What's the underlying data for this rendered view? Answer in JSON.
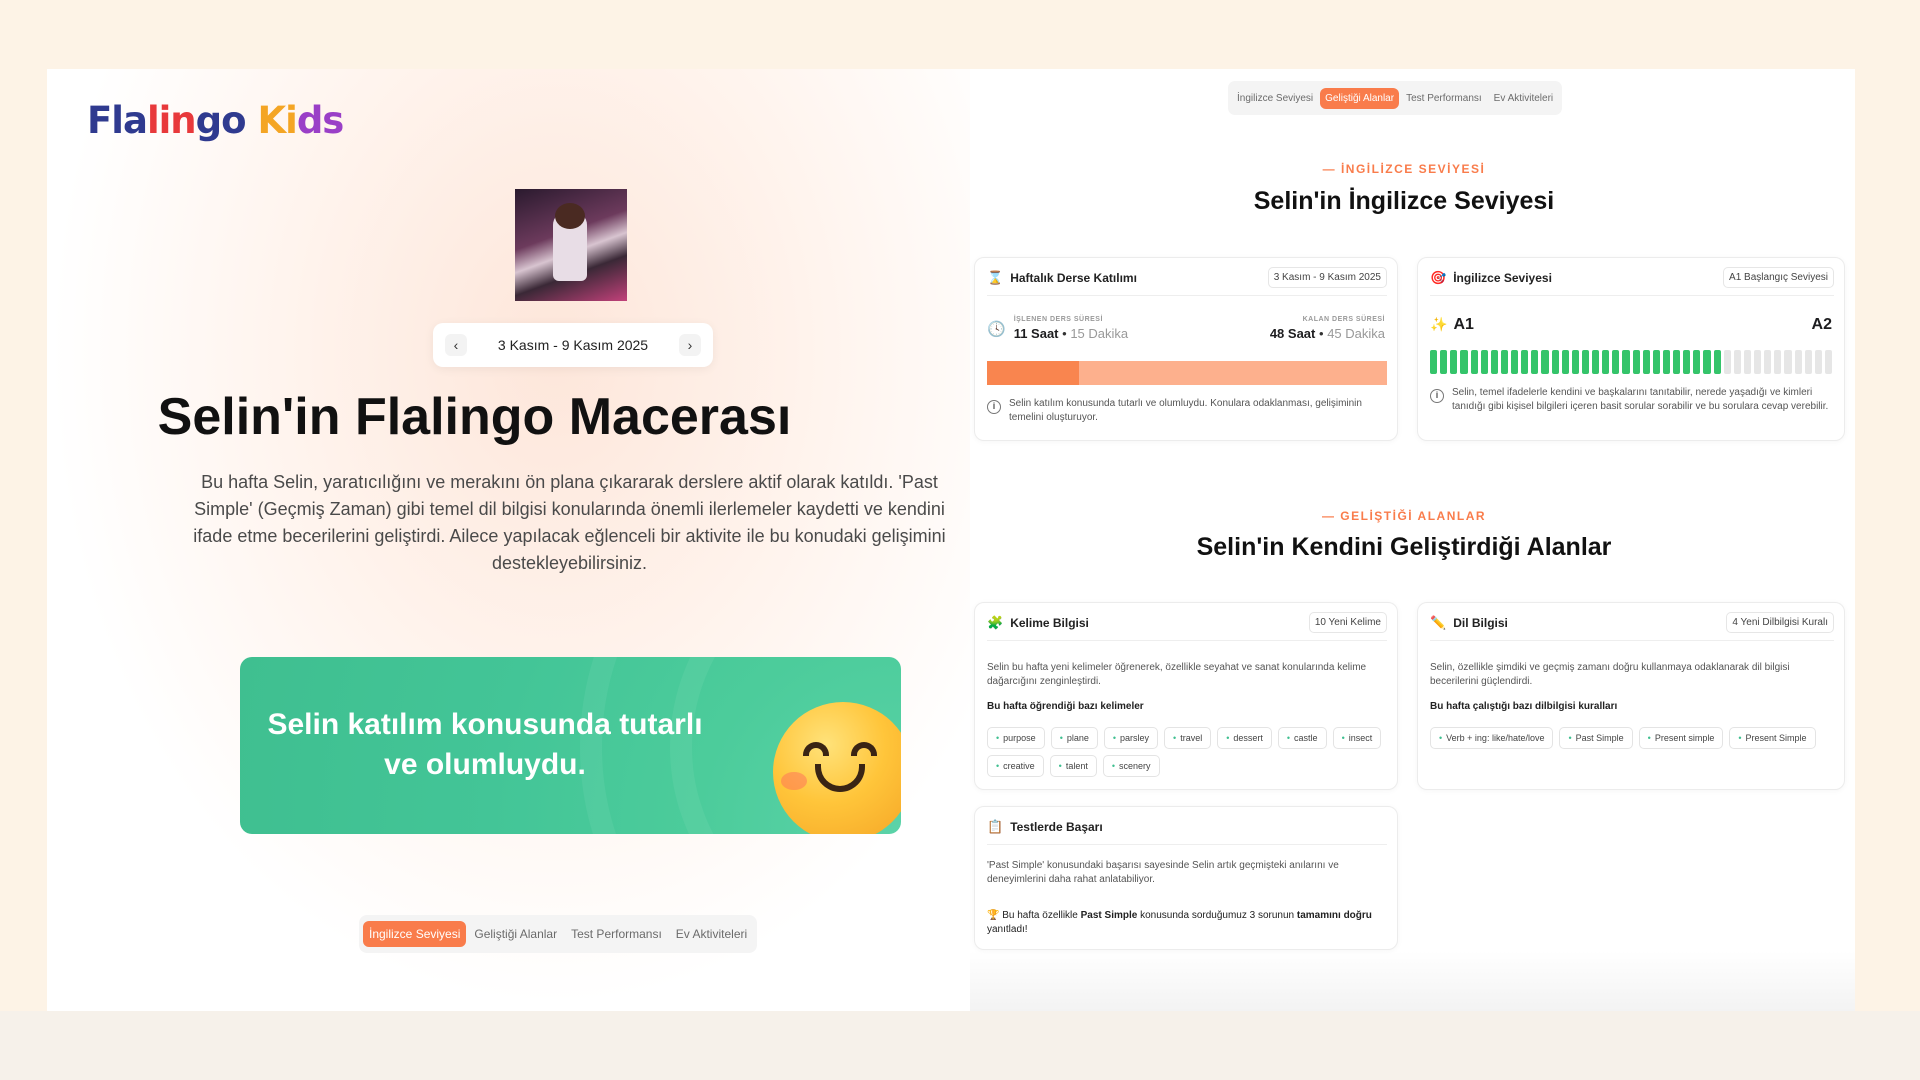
{
  "brand": {
    "parts": [
      "Fla",
      "lin",
      "go ",
      "Ki",
      "ds"
    ]
  },
  "hero": {
    "date_range": "3 Kasım - 9 Kasım 2025",
    "prev_icon": "‹",
    "next_icon": "›",
    "title": "Selin'in Flalingo Macerası",
    "intro": "Bu hafta Selin, yaratıcılığını ve merakını ön plana çıkararak derslere aktif olarak katıldı. 'Past Simple' (Geçmiş Zaman) gibi temel dil bilgisi konularında önemli ilerlemeler kaydetti ve kendini ifade etme becerilerini geliştirdi. Ailece yapılacak eğlenceli bir aktivite ile bu konudaki gelişimini destekleyebilirsiniz.",
    "banner_text": "Selin katılım konusunda tutarlı ve olumluydu."
  },
  "tabs": [
    "İngilizce Seviyesi",
    "Geliştiği Alanlar",
    "Test Performansı",
    "Ev Aktiviteleri"
  ],
  "tabs_active": {
    "bottom": 0,
    "top": 1
  },
  "level_section": {
    "eyebrow": "— İNGİLİZCE SEVİYESİ",
    "title": "Selin'in İngilizce Seviyesi",
    "attendance": {
      "title": "Haftalık Derse Katılımı",
      "pill": "3 Kasım - 9 Kasım 2025",
      "done_label": "İŞLENEN DERS SÜRESİ",
      "done_hours": "11 Saat",
      "done_minutes": "15 Dakika",
      "remaining_label": "KALAN DERS SÜRESİ",
      "remaining_hours": "48 Saat",
      "remaining_minutes": "45 Dakika",
      "progress_fraction": 0.23,
      "note": "Selin katılım konusunda tutarlı ve olumluydu. Konulara odaklanması, gelişiminin temelini oluşturuyor.",
      "icon": "hourglass-icon",
      "clock_icon": "clock-icon"
    },
    "english_level": {
      "title": "İngilizce Seviyesi",
      "pill": "A1 Başlangıç Seviyesi",
      "from": "A1",
      "to": "A2",
      "segments_total": 40,
      "segments_filled": 29,
      "note": "Selin, temel ifadelerle kendini ve başkalarını tanıtabilir, nerede yaşadığı ve kimleri tanıdığı gibi kişisel bilgileri içeren basit sorular sorabilir ve bu sorulara cevap verebilir.",
      "icon": "target-icon",
      "sparkle_icon": "sparkle-icon"
    }
  },
  "growth_section": {
    "eyebrow": "— GELİŞTİĞİ ALANLAR",
    "title": "Selin'in Kendini Geliştirdiği Alanlar",
    "vocab": {
      "title": "Kelime Bilgisi",
      "pill": "10 Yeni Kelime",
      "text": "Selin bu hafta yeni kelimeler öğrenerek, özellikle seyahat ve sanat konularında kelime dağarcığını zenginleştirdi.",
      "sub": "Bu hafta öğrendiği bazı kelimeler",
      "words": [
        "purpose",
        "plane",
        "parsley",
        "travel",
        "dessert",
        "castle",
        "insect",
        "creative",
        "talent",
        "scenery"
      ],
      "icon": "puzzle-icon"
    },
    "grammar": {
      "title": "Dil Bilgisi",
      "pill": "4 Yeni Dilbilgisi Kuralı",
      "text": "Selin, özellikle şimdiki ve geçmiş zamanı doğru kullanmaya odaklanarak dil bilgisi becerilerini güçlendirdi.",
      "sub": "Bu hafta çalıştığı bazı dilbilgisi kuralları",
      "rules": [
        "Verb + ing: like/hate/love",
        "Past Simple",
        "Present simple",
        "Present Simple"
      ],
      "icon": "pencil-icon"
    },
    "tests": {
      "title": "Testlerde Başarı",
      "text": "'Past Simple' konusundaki başarısı sayesinde Selin artık geçmişteki anılarını ve deneyimlerini daha rahat anlatabiliyor.",
      "result_pre": "Bu hafta özellikle ",
      "result_topic": "Past Simple",
      "result_mid": " konusunda sorduğumuz 3 sorunun ",
      "result_strong": "tamamını doğru",
      "result_post": " yanıtladı!",
      "icon": "clipboard-icon",
      "trophy_icon": "trophy-icon"
    }
  },
  "colors": {
    "accent": "#f97c4b",
    "green": "#3fbf90",
    "level_fill": "#34c46a"
  }
}
